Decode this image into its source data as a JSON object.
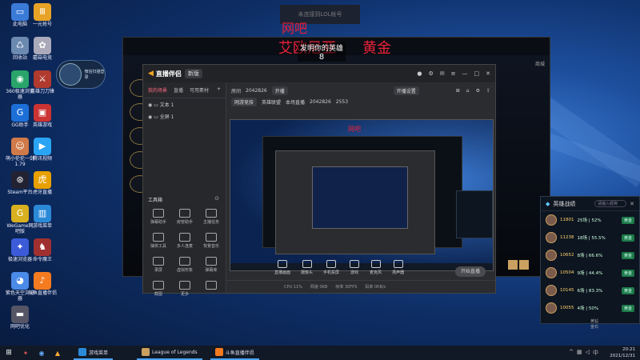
{
  "desktop": {
    "icons": [
      {
        "label": "此电脑",
        "glyph": "▭",
        "color": "#3b7bd8"
      },
      {
        "label": "一元抢号",
        "glyph": "Ⅲ",
        "color": "#e8a326"
      },
      {
        "label": "回收站",
        "glyph": "♺",
        "color": "#6c8ab0"
      },
      {
        "label": "蘑菇电竞",
        "glyph": "✿",
        "color": "#aab"
      },
      {
        "label": "360极速浏览器",
        "glyph": "◉",
        "color": "#29a56b"
      },
      {
        "label": "英雄刀刀锋",
        "glyph": "⚔",
        "color": "#b03a2e"
      },
      {
        "label": "GG助手",
        "glyph": "G",
        "color": "#1d6fd8"
      },
      {
        "label": "英雄游戏",
        "glyph": "▣",
        "color": "#c33"
      },
      {
        "label": "萌小伦伦一剑1.79",
        "glyph": "☺",
        "color": "#d07a4a"
      },
      {
        "label": "腾讯视频",
        "glyph": "▶",
        "color": "#2aa4f4"
      },
      {
        "label": "Steam平台",
        "glyph": "⊛",
        "color": "#223"
      },
      {
        "label": "虎牙直播",
        "glyph": "虎",
        "color": "#e8a000"
      },
      {
        "label": "WeGame网吧版",
        "glyph": "G",
        "color": "#d8b020"
      },
      {
        "label": "游戏菜单",
        "glyph": "▥",
        "color": "#2a8ad8"
      },
      {
        "label": "极速浏览器",
        "glyph": "✦",
        "color": "#3b5bd8"
      },
      {
        "label": "命令魔王",
        "glyph": "♞",
        "color": "#a03030"
      },
      {
        "label": "紫色天空浏览器",
        "glyph": "◕",
        "color": "#4a8ae8"
      },
      {
        "label": "斗鱼直播伴侣",
        "glyph": "♪",
        "color": "#f57b20"
      },
      {
        "label": "网吧优化",
        "glyph": "▬",
        "color": "#556"
      }
    ],
    "avatar_widget": "微信扫描登录"
  },
  "league": {
    "title_top": "未连接到LOL帐号",
    "red_line1": "网吧",
    "red_line2_a": "艾欧尼亚",
    "red_line2_b": "黄金",
    "notice": "发明你的英雄",
    "notice_num": "8",
    "top_right": "商城"
  },
  "streamer": {
    "app_name": "直播伴侣",
    "version_badge": "新版",
    "tabs": [
      "我的场景",
      "直播",
      "可用素材"
    ],
    "scenes": [
      "文本 1",
      "全屏 1"
    ],
    "room_label": "房间",
    "room_id": "2042826",
    "room_tag": "开播",
    "status_btn": "开播设置",
    "info2": [
      "网游竞技",
      "英雄联盟",
      "本场直播",
      "2042826",
      "2553"
    ],
    "tools_title": "工具箱",
    "tools": [
      "弹幕助手",
      "房管助手",
      "主播任务",
      "抽奖工具",
      "多人连麦",
      "背景音乐",
      "录屏",
      "虚拟形象",
      "弹幕库",
      "截图",
      "更多",
      ""
    ],
    "bottom_buttons": [
      "直播画面",
      "摄像头",
      "手机投屏",
      "游戏",
      "麦克风",
      "扬声器"
    ],
    "go_live": "开始直播",
    "status_items": [
      "CPU 11%",
      "网速 0KB",
      "帧率 30FPS",
      "码率 0KB/s"
    ]
  },
  "ranking": {
    "title": "英雄战绩",
    "search_placeholder": "请输入昵称",
    "players": [
      {
        "score": "11801",
        "stat": "25场 | 52%",
        "tag": "黄金"
      },
      {
        "score": "11238",
        "stat": "18场 | 55.5%",
        "tag": "黄金"
      },
      {
        "score": "10652",
        "stat": "8场 | 66.6%",
        "tag": "黄金"
      },
      {
        "score": "10504",
        "stat": "9场 | 44.4%",
        "tag": "黄金"
      },
      {
        "score": "10145",
        "stat": "6场 | 83.3%",
        "tag": "黄金"
      },
      {
        "score": "10055",
        "stat": "4场 | 50%",
        "tag": "黄金"
      }
    ],
    "footer_left": "黄金",
    "footer_right": "钻石"
  },
  "taskbar": {
    "items": [
      "游戏菜单",
      "League of Legends",
      "斗鱼直播伴侣"
    ],
    "time": "20:21",
    "date": "2021/12/31"
  }
}
